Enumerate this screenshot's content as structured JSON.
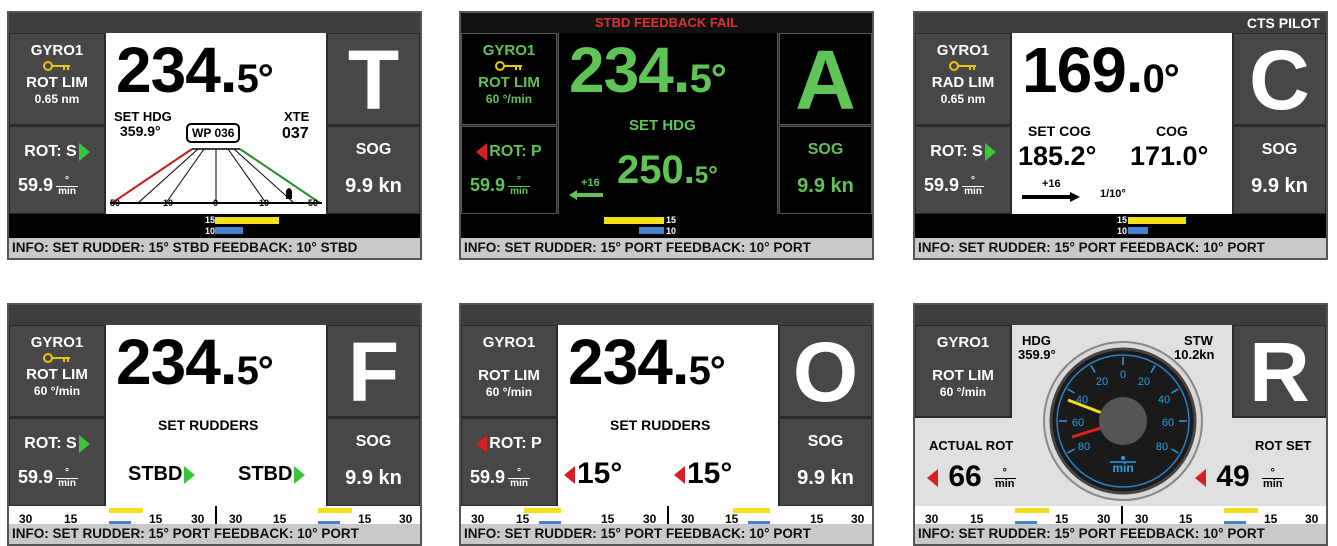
{
  "panels": [
    {
      "mode": "T",
      "gyro": "GYRO1",
      "lim": "ROT LIM",
      "lim_val": "0.65 nm",
      "rot": "ROT: S",
      "rot_val": "59.9",
      "unit_top": "°",
      "unit_bot": "min",
      "heading_int": "234.",
      "heading_dec": "5°",
      "set_label": "SET HDG",
      "set_val": "359.9°",
      "wp": "WP 036",
      "xte_label": "XTE",
      "xte_val": "037",
      "scale": [
        "50",
        "10",
        "0",
        "10",
        "50"
      ],
      "sog_label": "SOG",
      "sog_val": "9.9 kn",
      "bar_top": "15",
      "bar_bot": "10",
      "info": "INFO:  SET RUDDER: 15° STBD    FEEDBACK: 10° STBD"
    },
    {
      "mode": "A",
      "alarm": "STBD FEEDBACK FAIL",
      "gyro": "GYRO1",
      "lim": "ROT LIM",
      "lim_val": "60 °/min",
      "rot": "ROT: P",
      "rot_val": "59.9",
      "unit_top": "°",
      "unit_bot": "min",
      "heading_int": "234.",
      "heading_dec": "5°",
      "set_label": "SET HDG",
      "set_int": "250.",
      "set_dec": "5°",
      "arrow_val": "+16",
      "sog_label": "SOG",
      "sog_val": "9.9 kn",
      "bar_top": "15",
      "bar_bot": "10",
      "info": "INFO:  SET RUDDER: 15° PORT    FEEDBACK: 10° PORT"
    },
    {
      "mode": "C",
      "top_label": "CTS PILOT",
      "gyro": "GYRO1",
      "lim": "RAD LIM",
      "lim_val": "0.65 nm",
      "rot": "ROT: S",
      "rot_val": "59.9",
      "unit_top": "°",
      "unit_bot": "min",
      "heading_int": "169.",
      "heading_dec": "0°",
      "set_label": "SET COG",
      "set_val": "185.2°",
      "cog_label": "COG",
      "cog_val": "171.0°",
      "arrow_val": "+16",
      "ratio": "1/10°",
      "sog_label": "SOG",
      "sog_val": "9.9 kn",
      "bar_top": "15",
      "bar_bot": "10",
      "info": "INFO:  SET RUDDER: 15° PORT    FEEDBACK: 10° PORT"
    },
    {
      "mode": "F",
      "gyro": "GYRO1",
      "lim": "ROT LIM",
      "lim_val": "60 °/min",
      "rot": "ROT: S",
      "rot_val": "59.9",
      "unit_top": "°",
      "unit_bot": "min",
      "heading_int": "234.",
      "heading_dec": "5°",
      "set_label": "SET RUDDERS",
      "r1": "STBD",
      "r2": "STBD",
      "sog_label": "SOG",
      "sog_val": "9.9 kn",
      "scale": [
        "30",
        "15",
        "15",
        "30",
        "30",
        "15",
        "15",
        "30"
      ],
      "info": "INFO:  SET RUDDER: 15° PORT    FEEDBACK: 10° PORT"
    },
    {
      "mode": "O",
      "gyro": "GYRO1",
      "lim": "ROT LIM",
      "lim_val": "60 °/min",
      "rot": "ROT: P",
      "rot_val": "59.9",
      "unit_top": "°",
      "unit_bot": "min",
      "heading_int": "234.",
      "heading_dec": "5°",
      "set_label": "SET RUDDERS",
      "r1": "15°",
      "r2": "15°",
      "sog_label": "SOG",
      "sog_val": "9.9 kn",
      "scale": [
        "30",
        "15",
        "15",
        "30",
        "30",
        "15",
        "15",
        "30"
      ],
      "info": "INFO:  SET RUDDER: 15° PORT    FEEDBACK: 10° PORT"
    },
    {
      "mode": "R",
      "gyro": "GYRO1",
      "lim": "ROT LIM",
      "lim_val": "60 °/min",
      "hdg_label": "HDG",
      "hdg_val": "359.9°",
      "stw_label": "STW",
      "stw_val": "10.2kn",
      "actual_label": "ACTUAL ROT",
      "actual_val": "66",
      "set_label": "ROT SET",
      "set_val": "49",
      "unit_top": "°",
      "unit_bot": "min",
      "dial": [
        "0",
        "20",
        "40",
        "60",
        "80",
        "20",
        "40",
        "60",
        "80"
      ],
      "dial_unit": "min",
      "scale": [
        "30",
        "15",
        "15",
        "30",
        "30",
        "15",
        "15",
        "30"
      ],
      "info": "INFO:  SET RUDDER: 15° PORT    FEEDBACK: 10° PORT"
    }
  ]
}
